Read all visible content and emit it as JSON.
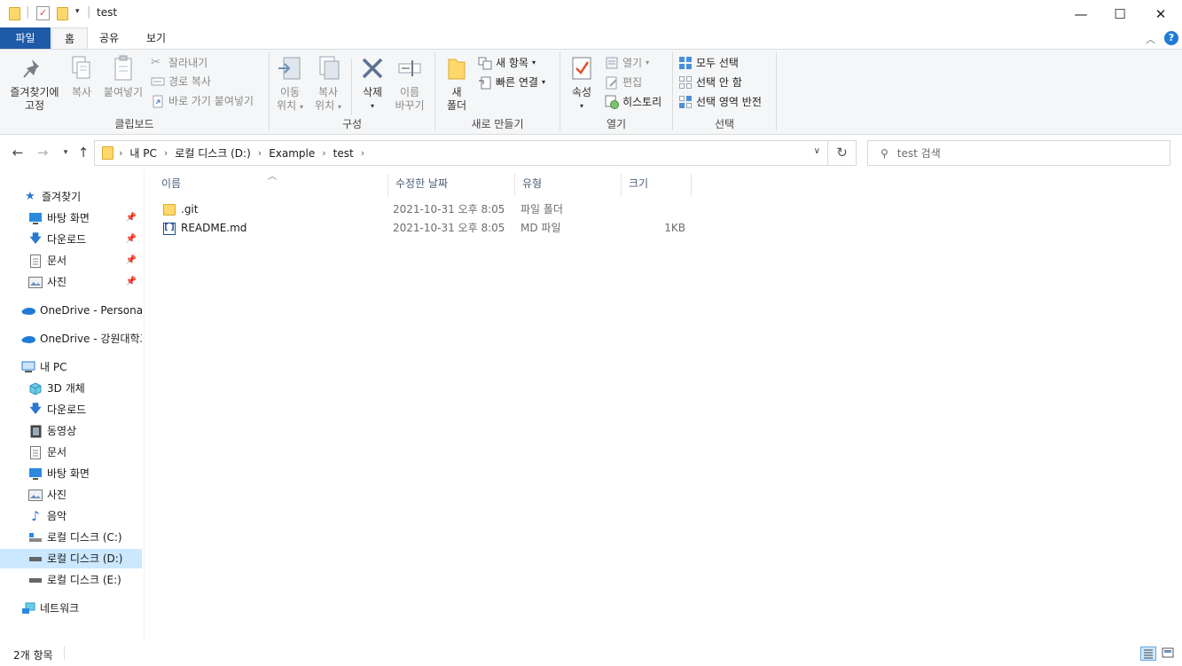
{
  "window": {
    "title": "test",
    "quick_access_sep": "|",
    "minimize": "—",
    "maximize": "☐",
    "close": "✕"
  },
  "tabs": {
    "file": "파일",
    "home": "홈",
    "share": "공유",
    "view": "보기"
  },
  "ribbon": {
    "clipboard": {
      "pin_line1": "즐겨찾기에",
      "pin_line2": "고정",
      "copy": "복사",
      "paste": "붙여넣기",
      "cut": "잘라내기",
      "copy_path": "경로 복사",
      "paste_shortcut": "바로 가기 붙여넣기",
      "label": "클립보드"
    },
    "organize": {
      "move_line1": "이동",
      "move_line2": "위치",
      "copyto_line1": "복사",
      "copyto_line2": "위치",
      "delete": "삭제",
      "rename_line1": "이름",
      "rename_line2": "바꾸기",
      "label": "구성"
    },
    "new": {
      "folder_line1": "새",
      "folder_line2": "폴더",
      "new_item": "새 항목",
      "easy_access": "빠른 연결",
      "label": "새로 만들기"
    },
    "open": {
      "properties": "속성",
      "open": "열기",
      "edit": "편집",
      "history": "히스토리",
      "label": "열기"
    },
    "select": {
      "select_all": "모두 선택",
      "select_none": "선택 안 함",
      "invert": "선택 영역 반전",
      "label": "선택"
    }
  },
  "address": {
    "crumbs": [
      "내 PC",
      "로컬 디스크 (D:)",
      "Example",
      "test"
    ],
    "search_placeholder": "test 검색"
  },
  "nav": {
    "quick_access": "즐겨찾기",
    "qa_items": [
      "바탕 화면",
      "다운로드",
      "문서",
      "사진"
    ],
    "onedrive_personal": "OneDrive - Personal",
    "onedrive_org": "OneDrive - 강원대학교",
    "this_pc": "내 PC",
    "pc_items": [
      "3D 개체",
      "다운로드",
      "동영상",
      "문서",
      "바탕 화면",
      "사진",
      "음악",
      "로컬 디스크 (C:)",
      "로컬 디스크 (D:)",
      "로컬 디스크 (E:)"
    ],
    "network": "네트워크"
  },
  "files": {
    "columns": [
      "이름",
      "수정한 날짜",
      "유형",
      "크기"
    ],
    "rows": [
      {
        "name": ".git",
        "date": "2021-10-31 오후 8:05",
        "type": "파일 폴더",
        "size": ""
      },
      {
        "name": "README.md",
        "date": "2021-10-31 오후 8:05",
        "type": "MD 파일",
        "size": "1KB"
      }
    ]
  },
  "status": {
    "count": "2개 항목"
  },
  "colors": {
    "file_tab": "#1f5aa8",
    "selection": "#cce8ff",
    "folder": "#ffd86b",
    "accent_blue": "#1f7bd6"
  }
}
